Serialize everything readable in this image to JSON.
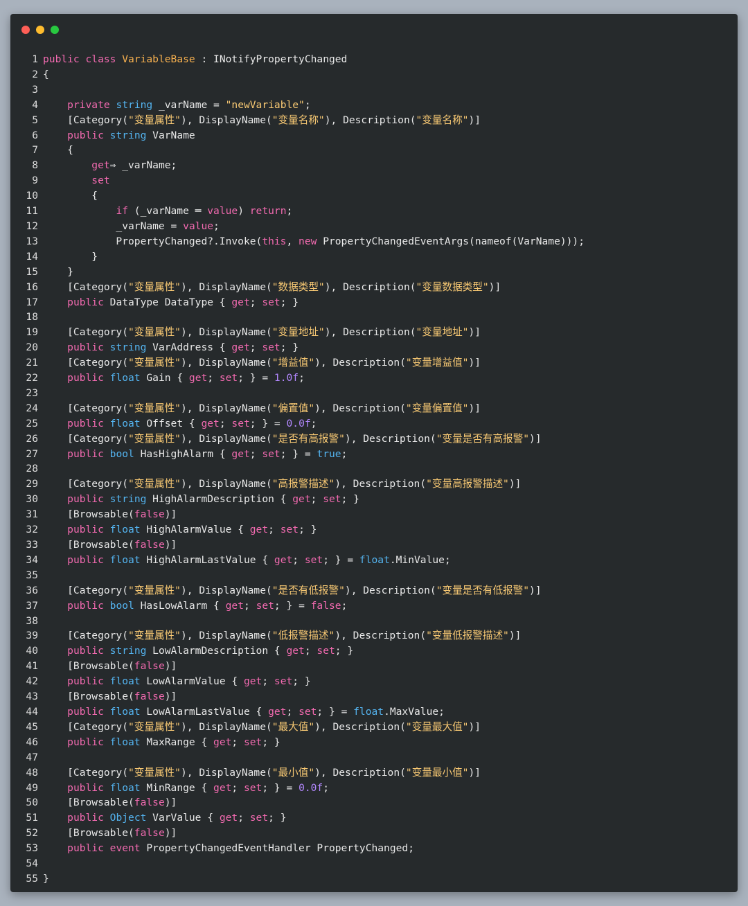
{
  "window": {
    "buttons": [
      "close",
      "minimize",
      "maximize"
    ],
    "colors": {
      "background": "#262a2c",
      "keyword": "#f26ab0",
      "type": "#54b4f0",
      "class": "#f6b04f",
      "string": "#f7c873",
      "number": "#b388ff",
      "text": "#e8e8e8"
    }
  },
  "code": {
    "language": "csharp",
    "lines": [
      [
        [
          "k",
          "public"
        ],
        [
          "p",
          " "
        ],
        [
          "k",
          "class"
        ],
        [
          "p",
          " "
        ],
        [
          "c",
          "VariableBase"
        ],
        [
          "p",
          " : INotifyPropertyChanged"
        ]
      ],
      [
        [
          "p",
          "{"
        ]
      ],
      [],
      [
        [
          "p",
          "    "
        ],
        [
          "k",
          "private"
        ],
        [
          "p",
          " "
        ],
        [
          "t",
          "string"
        ],
        [
          "p",
          " _varName = "
        ],
        [
          "s",
          "\"newVariable\""
        ],
        [
          "p",
          ";"
        ]
      ],
      [
        [
          "p",
          "    [Category("
        ],
        [
          "s",
          "\"变量属性\""
        ],
        [
          "p",
          "), DisplayName("
        ],
        [
          "s",
          "\"变量名称\""
        ],
        [
          "p",
          "), Description("
        ],
        [
          "s",
          "\"变量名称\""
        ],
        [
          "p",
          ")]"
        ]
      ],
      [
        [
          "p",
          "    "
        ],
        [
          "k",
          "public"
        ],
        [
          "p",
          " "
        ],
        [
          "t",
          "string"
        ],
        [
          "p",
          " VarName"
        ]
      ],
      [
        [
          "p",
          "    {"
        ]
      ],
      [
        [
          "p",
          "        "
        ],
        [
          "k",
          "get"
        ],
        [
          "p",
          "⇒ _varName;"
        ]
      ],
      [
        [
          "p",
          "        "
        ],
        [
          "k",
          "set"
        ]
      ],
      [
        [
          "p",
          "        {"
        ]
      ],
      [
        [
          "p",
          "            "
        ],
        [
          "k",
          "if"
        ],
        [
          "p",
          " (_varName ═ "
        ],
        [
          "k",
          "value"
        ],
        [
          "p",
          ") "
        ],
        [
          "k",
          "return"
        ],
        [
          "p",
          ";"
        ]
      ],
      [
        [
          "p",
          "            _varName = "
        ],
        [
          "k",
          "value"
        ],
        [
          "p",
          ";"
        ]
      ],
      [
        [
          "p",
          "            PropertyChanged?.Invoke("
        ],
        [
          "k",
          "this"
        ],
        [
          "p",
          ", "
        ],
        [
          "k",
          "new"
        ],
        [
          "p",
          " PropertyChangedEventArgs(nameof(VarName)));"
        ]
      ],
      [
        [
          "p",
          "        }"
        ]
      ],
      [
        [
          "p",
          "    }"
        ]
      ],
      [
        [
          "p",
          "    [Category("
        ],
        [
          "s",
          "\"变量属性\""
        ],
        [
          "p",
          "), DisplayName("
        ],
        [
          "s",
          "\"数据类型\""
        ],
        [
          "p",
          "), Description("
        ],
        [
          "s",
          "\"变量数据类型\""
        ],
        [
          "p",
          ")]"
        ]
      ],
      [
        [
          "p",
          "    "
        ],
        [
          "k",
          "public"
        ],
        [
          "p",
          " DataType DataType { "
        ],
        [
          "k",
          "get"
        ],
        [
          "p",
          "; "
        ],
        [
          "k",
          "set"
        ],
        [
          "p",
          "; }"
        ]
      ],
      [],
      [
        [
          "p",
          "    [Category("
        ],
        [
          "s",
          "\"变量属性\""
        ],
        [
          "p",
          "), DisplayName("
        ],
        [
          "s",
          "\"变量地址\""
        ],
        [
          "p",
          "), Description("
        ],
        [
          "s",
          "\"变量地址\""
        ],
        [
          "p",
          ")]"
        ]
      ],
      [
        [
          "p",
          "    "
        ],
        [
          "k",
          "public"
        ],
        [
          "p",
          " "
        ],
        [
          "t",
          "string"
        ],
        [
          "p",
          " VarAddress { "
        ],
        [
          "k",
          "get"
        ],
        [
          "p",
          "; "
        ],
        [
          "k",
          "set"
        ],
        [
          "p",
          "; }"
        ]
      ],
      [
        [
          "p",
          "    [Category("
        ],
        [
          "s",
          "\"变量属性\""
        ],
        [
          "p",
          "), DisplayName("
        ],
        [
          "s",
          "\"增益值\""
        ],
        [
          "p",
          "), Description("
        ],
        [
          "s",
          "\"变量增益值\""
        ],
        [
          "p",
          ")]"
        ]
      ],
      [
        [
          "p",
          "    "
        ],
        [
          "k",
          "public"
        ],
        [
          "p",
          " "
        ],
        [
          "t",
          "float"
        ],
        [
          "p",
          " Gain { "
        ],
        [
          "k",
          "get"
        ],
        [
          "p",
          "; "
        ],
        [
          "k",
          "set"
        ],
        [
          "p",
          "; } = "
        ],
        [
          "n",
          "1.0f"
        ],
        [
          "p",
          ";"
        ]
      ],
      [],
      [
        [
          "p",
          "    [Category("
        ],
        [
          "s",
          "\"变量属性\""
        ],
        [
          "p",
          "), DisplayName("
        ],
        [
          "s",
          "\"偏置值\""
        ],
        [
          "p",
          "), Description("
        ],
        [
          "s",
          "\"变量偏置值\""
        ],
        [
          "p",
          ")]"
        ]
      ],
      [
        [
          "p",
          "    "
        ],
        [
          "k",
          "public"
        ],
        [
          "p",
          " "
        ],
        [
          "t",
          "float"
        ],
        [
          "p",
          " Offset { "
        ],
        [
          "k",
          "get"
        ],
        [
          "p",
          "; "
        ],
        [
          "k",
          "set"
        ],
        [
          "p",
          "; } = "
        ],
        [
          "n",
          "0.0f"
        ],
        [
          "p",
          ";"
        ]
      ],
      [
        [
          "p",
          "    [Category("
        ],
        [
          "s",
          "\"变量属性\""
        ],
        [
          "p",
          "), DisplayName("
        ],
        [
          "s",
          "\"是否有高报警\""
        ],
        [
          "p",
          "), Description("
        ],
        [
          "s",
          "\"变量是否有高报警\""
        ],
        [
          "p",
          ")]"
        ]
      ],
      [
        [
          "p",
          "    "
        ],
        [
          "k",
          "public"
        ],
        [
          "p",
          " "
        ],
        [
          "t",
          "bool"
        ],
        [
          "p",
          " HasHighAlarm { "
        ],
        [
          "k",
          "get"
        ],
        [
          "p",
          "; "
        ],
        [
          "k",
          "set"
        ],
        [
          "p",
          "; } = "
        ],
        [
          "t",
          "true"
        ],
        [
          "p",
          ";"
        ]
      ],
      [],
      [
        [
          "p",
          "    [Category("
        ],
        [
          "s",
          "\"变量属性\""
        ],
        [
          "p",
          "), DisplayName("
        ],
        [
          "s",
          "\"高报警描述\""
        ],
        [
          "p",
          "), Description("
        ],
        [
          "s",
          "\"变量高报警描述\""
        ],
        [
          "p",
          ")]"
        ]
      ],
      [
        [
          "p",
          "    "
        ],
        [
          "k",
          "public"
        ],
        [
          "p",
          " "
        ],
        [
          "t",
          "string"
        ],
        [
          "p",
          " HighAlarmDescription { "
        ],
        [
          "k",
          "get"
        ],
        [
          "p",
          "; "
        ],
        [
          "k",
          "set"
        ],
        [
          "p",
          "; }"
        ]
      ],
      [
        [
          "p",
          "    [Browsable("
        ],
        [
          "k",
          "false"
        ],
        [
          "p",
          ")]"
        ]
      ],
      [
        [
          "p",
          "    "
        ],
        [
          "k",
          "public"
        ],
        [
          "p",
          " "
        ],
        [
          "t",
          "float"
        ],
        [
          "p",
          " HighAlarmValue { "
        ],
        [
          "k",
          "get"
        ],
        [
          "p",
          "; "
        ],
        [
          "k",
          "set"
        ],
        [
          "p",
          "; }"
        ]
      ],
      [
        [
          "p",
          "    [Browsable("
        ],
        [
          "k",
          "false"
        ],
        [
          "p",
          ")]"
        ]
      ],
      [
        [
          "p",
          "    "
        ],
        [
          "k",
          "public"
        ],
        [
          "p",
          " "
        ],
        [
          "t",
          "float"
        ],
        [
          "p",
          " HighAlarmLastValue { "
        ],
        [
          "k",
          "get"
        ],
        [
          "p",
          "; "
        ],
        [
          "k",
          "set"
        ],
        [
          "p",
          "; } = "
        ],
        [
          "t",
          "float"
        ],
        [
          "p",
          ".MinValue;"
        ]
      ],
      [],
      [
        [
          "p",
          "    [Category("
        ],
        [
          "s",
          "\"变量属性\""
        ],
        [
          "p",
          "), DisplayName("
        ],
        [
          "s",
          "\"是否有低报警\""
        ],
        [
          "p",
          "), Description("
        ],
        [
          "s",
          "\"变量是否有低报警\""
        ],
        [
          "p",
          ")]"
        ]
      ],
      [
        [
          "p",
          "    "
        ],
        [
          "k",
          "public"
        ],
        [
          "p",
          " "
        ],
        [
          "t",
          "bool"
        ],
        [
          "p",
          " HasLowAlarm { "
        ],
        [
          "k",
          "get"
        ],
        [
          "p",
          "; "
        ],
        [
          "k",
          "set"
        ],
        [
          "p",
          "; } = "
        ],
        [
          "k",
          "false"
        ],
        [
          "p",
          ";"
        ]
      ],
      [],
      [
        [
          "p",
          "    [Category("
        ],
        [
          "s",
          "\"变量属性\""
        ],
        [
          "p",
          "), DisplayName("
        ],
        [
          "s",
          "\"低报警描述\""
        ],
        [
          "p",
          "), Description("
        ],
        [
          "s",
          "\"变量低报警描述\""
        ],
        [
          "p",
          ")]"
        ]
      ],
      [
        [
          "p",
          "    "
        ],
        [
          "k",
          "public"
        ],
        [
          "p",
          " "
        ],
        [
          "t",
          "string"
        ],
        [
          "p",
          " LowAlarmDescription { "
        ],
        [
          "k",
          "get"
        ],
        [
          "p",
          "; "
        ],
        [
          "k",
          "set"
        ],
        [
          "p",
          "; }"
        ]
      ],
      [
        [
          "p",
          "    [Browsable("
        ],
        [
          "k",
          "false"
        ],
        [
          "p",
          ")]"
        ]
      ],
      [
        [
          "p",
          "    "
        ],
        [
          "k",
          "public"
        ],
        [
          "p",
          " "
        ],
        [
          "t",
          "float"
        ],
        [
          "p",
          " LowAlarmValue { "
        ],
        [
          "k",
          "get"
        ],
        [
          "p",
          "; "
        ],
        [
          "k",
          "set"
        ],
        [
          "p",
          "; }"
        ]
      ],
      [
        [
          "p",
          "    [Browsable("
        ],
        [
          "k",
          "false"
        ],
        [
          "p",
          ")]"
        ]
      ],
      [
        [
          "p",
          "    "
        ],
        [
          "k",
          "public"
        ],
        [
          "p",
          " "
        ],
        [
          "t",
          "float"
        ],
        [
          "p",
          " LowAlarmLastValue { "
        ],
        [
          "k",
          "get"
        ],
        [
          "p",
          "; "
        ],
        [
          "k",
          "set"
        ],
        [
          "p",
          "; } = "
        ],
        [
          "t",
          "float"
        ],
        [
          "p",
          ".MaxValue;"
        ]
      ],
      [
        [
          "p",
          "    [Category("
        ],
        [
          "s",
          "\"变量属性\""
        ],
        [
          "p",
          "), DisplayName("
        ],
        [
          "s",
          "\"最大值\""
        ],
        [
          "p",
          "), Description("
        ],
        [
          "s",
          "\"变量最大值\""
        ],
        [
          "p",
          ")]"
        ]
      ],
      [
        [
          "p",
          "    "
        ],
        [
          "k",
          "public"
        ],
        [
          "p",
          " "
        ],
        [
          "t",
          "float"
        ],
        [
          "p",
          " MaxRange { "
        ],
        [
          "k",
          "get"
        ],
        [
          "p",
          "; "
        ],
        [
          "k",
          "set"
        ],
        [
          "p",
          "; }"
        ]
      ],
      [],
      [
        [
          "p",
          "    [Category("
        ],
        [
          "s",
          "\"变量属性\""
        ],
        [
          "p",
          "), DisplayName("
        ],
        [
          "s",
          "\"最小值\""
        ],
        [
          "p",
          "), Description("
        ],
        [
          "s",
          "\"变量最小值\""
        ],
        [
          "p",
          ")]"
        ]
      ],
      [
        [
          "p",
          "    "
        ],
        [
          "k",
          "public"
        ],
        [
          "p",
          " "
        ],
        [
          "t",
          "float"
        ],
        [
          "p",
          " MinRange { "
        ],
        [
          "k",
          "get"
        ],
        [
          "p",
          "; "
        ],
        [
          "k",
          "set"
        ],
        [
          "p",
          "; } = "
        ],
        [
          "n",
          "0.0f"
        ],
        [
          "p",
          ";"
        ]
      ],
      [
        [
          "p",
          "    [Browsable("
        ],
        [
          "k",
          "false"
        ],
        [
          "p",
          ")]"
        ]
      ],
      [
        [
          "p",
          "    "
        ],
        [
          "k",
          "public"
        ],
        [
          "p",
          " "
        ],
        [
          "t",
          "Object"
        ],
        [
          "p",
          " VarValue { "
        ],
        [
          "k",
          "get"
        ],
        [
          "p",
          "; "
        ],
        [
          "k",
          "set"
        ],
        [
          "p",
          "; }"
        ]
      ],
      [
        [
          "p",
          "    [Browsable("
        ],
        [
          "k",
          "false"
        ],
        [
          "p",
          ")]"
        ]
      ],
      [
        [
          "p",
          "    "
        ],
        [
          "k",
          "public"
        ],
        [
          "p",
          " "
        ],
        [
          "k",
          "event"
        ],
        [
          "p",
          " PropertyChangedEventHandler PropertyChanged;"
        ]
      ],
      [],
      [
        [
          "p",
          "}"
        ]
      ]
    ]
  }
}
